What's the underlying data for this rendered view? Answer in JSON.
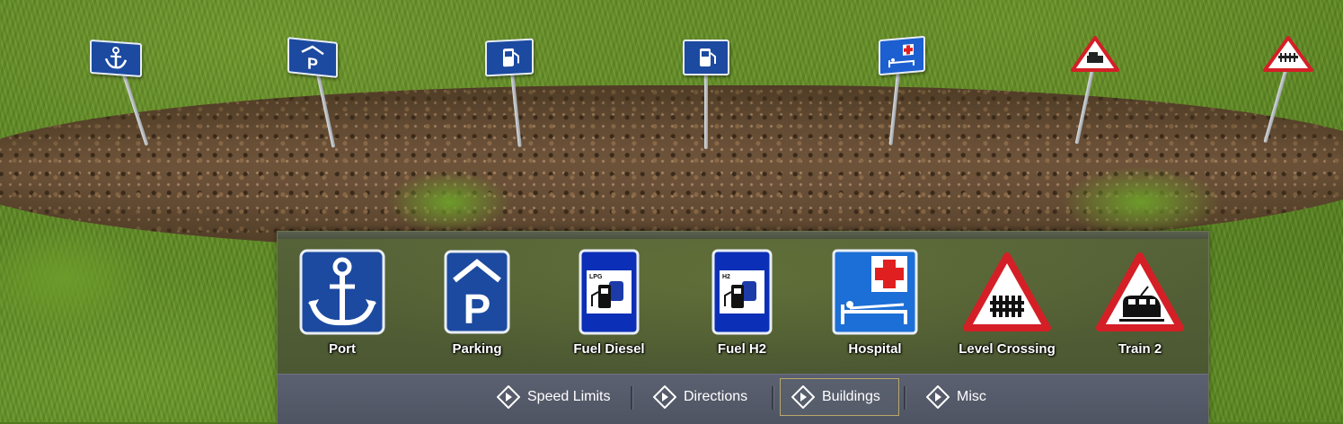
{
  "palette": {
    "items": [
      {
        "label": "Port",
        "icon": "anchor-icon",
        "color": "#1c4aa0"
      },
      {
        "label": "Parking",
        "icon": "covered-parking-icon",
        "color": "#1c4aa0"
      },
      {
        "label": "Fuel Diesel",
        "icon": "lpg-fuel-pump-icon",
        "color": "#0b2fb6"
      },
      {
        "label": "Fuel H2",
        "icon": "h2-fuel-pump-icon",
        "color": "#0b2fb6"
      },
      {
        "label": "Hospital",
        "icon": "hospital-bed-icon",
        "color": "#1c6fd6"
      },
      {
        "label": "Level Crossing",
        "icon": "level-crossing-warning-icon",
        "color": "#d41f26"
      },
      {
        "label": "Train 2",
        "icon": "train-warning-icon",
        "color": "#d41f26"
      }
    ],
    "fuel_labels": {
      "lpg": "LPG",
      "h2": "H2"
    }
  },
  "tabs": [
    {
      "label": "Speed Limits",
      "icon": "diamond-arrow-icon",
      "active": false
    },
    {
      "label": "Directions",
      "icon": "diamond-arrow-icon",
      "active": false
    },
    {
      "label": "Buildings",
      "icon": "diamond-arrow-icon",
      "active": true
    },
    {
      "label": "Misc",
      "icon": "diamond-arrow-icon",
      "active": false
    }
  ],
  "world_signs": [
    {
      "icon": "anchor-icon"
    },
    {
      "icon": "covered-parking-icon"
    },
    {
      "icon": "fuel-pump-icon"
    },
    {
      "icon": "fuel-pump-icon"
    },
    {
      "icon": "hospital-bed-icon"
    },
    {
      "icon": "train-warning-icon"
    },
    {
      "icon": "level-crossing-warning-icon"
    }
  ]
}
